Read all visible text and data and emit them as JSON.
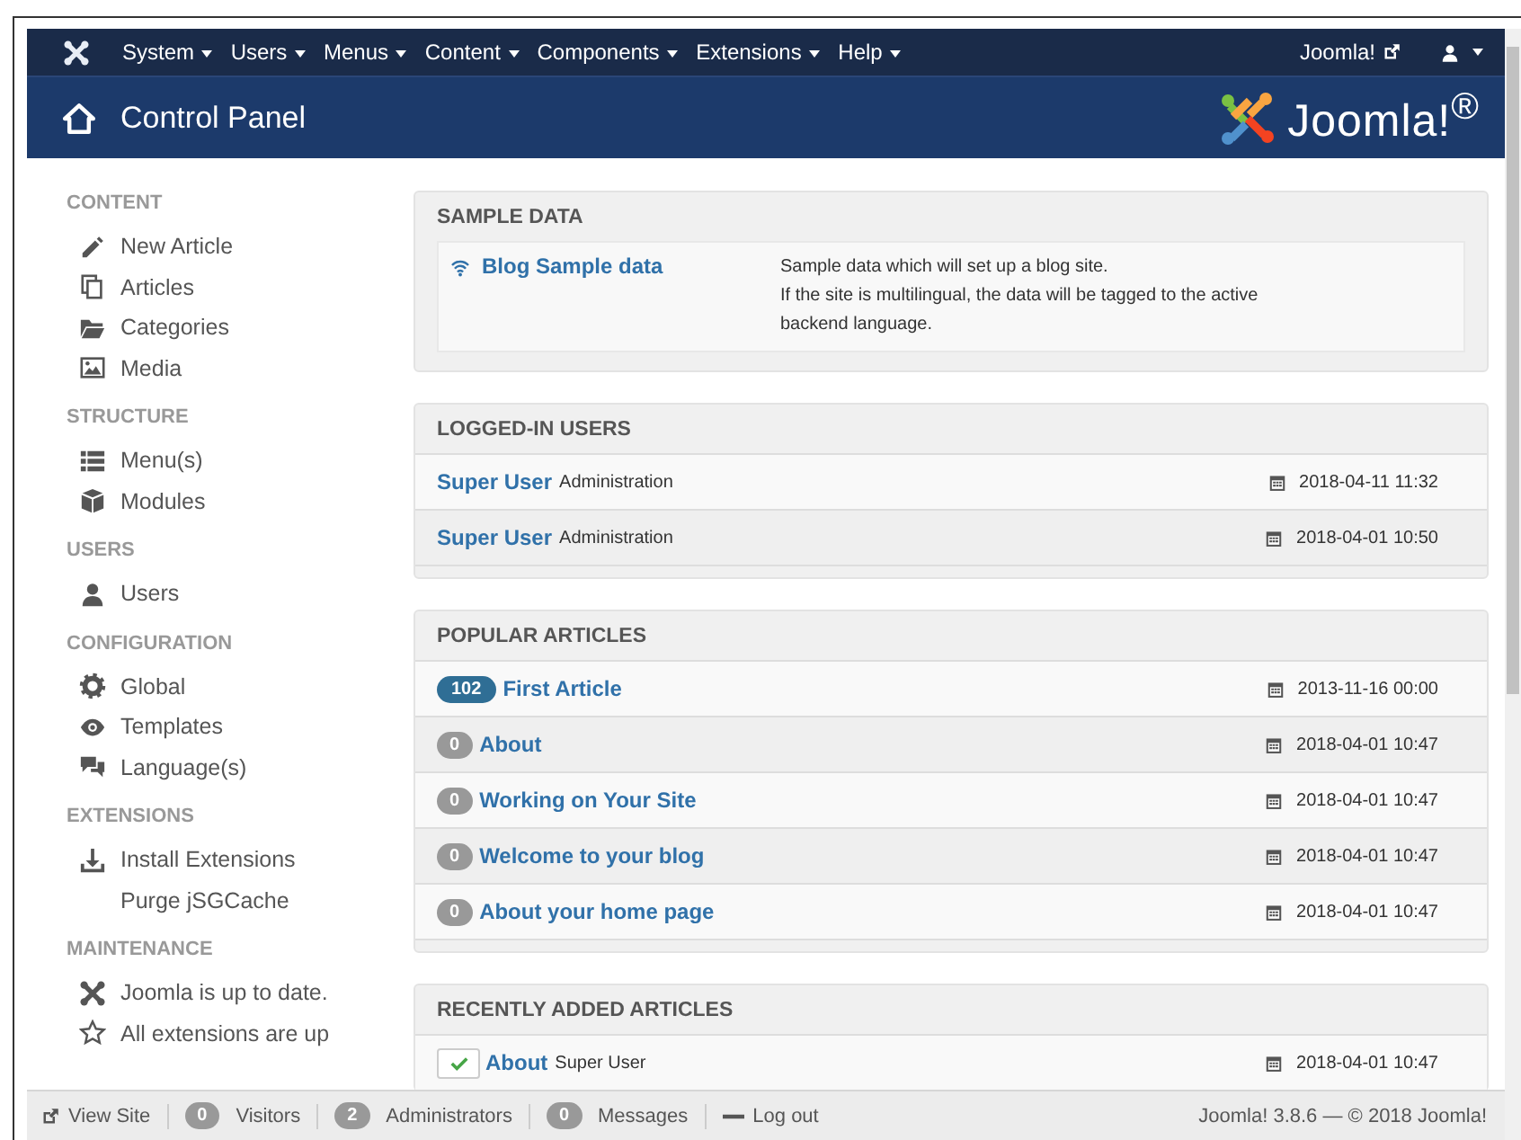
{
  "navbar": {
    "menus": [
      {
        "label": "System"
      },
      {
        "label": "Users"
      },
      {
        "label": "Menus"
      },
      {
        "label": "Content"
      },
      {
        "label": "Components"
      },
      {
        "label": "Extensions"
      },
      {
        "label": "Help"
      }
    ],
    "site_link": "Joomla!"
  },
  "header": {
    "title": "Control Panel",
    "logo_text": "Joomla!$^{®}$"
  },
  "sidebar": {
    "sections": [
      {
        "title": "CONTENT",
        "items": [
          {
            "label": "New Article"
          },
          {
            "label": "Articles"
          },
          {
            "label": "Categories"
          },
          {
            "label": "Media"
          }
        ]
      },
      {
        "title": "STRUCTURE",
        "items": [
          {
            "label": "Menu(s)"
          },
          {
            "label": "Modules"
          }
        ]
      },
      {
        "title": "USERS",
        "items": [
          {
            "label": "Users"
          }
        ]
      },
      {
        "title": "CONFIGURATION",
        "items": [
          {
            "label": "Global"
          },
          {
            "label": "Templates"
          },
          {
            "label": "Language(s)"
          }
        ]
      },
      {
        "title": "EXTENSIONS",
        "items": [
          {
            "label": "Install Extensions"
          },
          {
            "label": "Purge jSGCache"
          }
        ]
      },
      {
        "title": "MAINTENANCE",
        "items": [
          {
            "label": "Joomla is up to date."
          },
          {
            "label": "All extensions are up"
          }
        ]
      }
    ]
  },
  "sample_data": {
    "title": "SAMPLE DATA",
    "link": "Blog Sample data",
    "description": [
      "Sample data which will set up a blog site.",
      "If the site is multilingual, the data will be tagged to the active backend language."
    ]
  },
  "logged_in_users": {
    "title": "LOGGED-IN USERS",
    "rows": [
      {
        "name": "Super User",
        "client": "Administration",
        "date": "2018-04-11 11:32"
      },
      {
        "name": "Super User",
        "client": "Administration",
        "date": "2018-04-01 10:50"
      }
    ]
  },
  "popular_articles": {
    "title": "POPULAR ARTICLES",
    "rows": [
      {
        "hits": "102",
        "highlighted": true,
        "title": "First Article",
        "date": "2013-11-16 00:00"
      },
      {
        "hits": "0",
        "highlighted": false,
        "title": "About",
        "date": "2018-04-01 10:47"
      },
      {
        "hits": "0",
        "highlighted": false,
        "title": "Working on Your Site",
        "date": "2018-04-01 10:47"
      },
      {
        "hits": "0",
        "highlighted": false,
        "title": "Welcome to your blog",
        "date": "2018-04-01 10:47"
      },
      {
        "hits": "0",
        "highlighted": false,
        "title": "About your home page",
        "date": "2018-04-01 10:47"
      }
    ]
  },
  "recent_articles": {
    "title": "RECENTLY ADDED ARTICLES",
    "rows": [
      {
        "published": true,
        "title": "About",
        "author": "Super User",
        "date": "2018-04-01 10:47"
      }
    ]
  },
  "status_bar": {
    "view_site": "View Site",
    "counters": [
      {
        "count": "0",
        "label": "Visitors"
      },
      {
        "count": "2",
        "label": "Administrators"
      },
      {
        "count": "0",
        "label": "Messages"
      }
    ],
    "logout": "Log out",
    "version": "Joomla! 3.8.6 — © 2018 Joomla!"
  }
}
